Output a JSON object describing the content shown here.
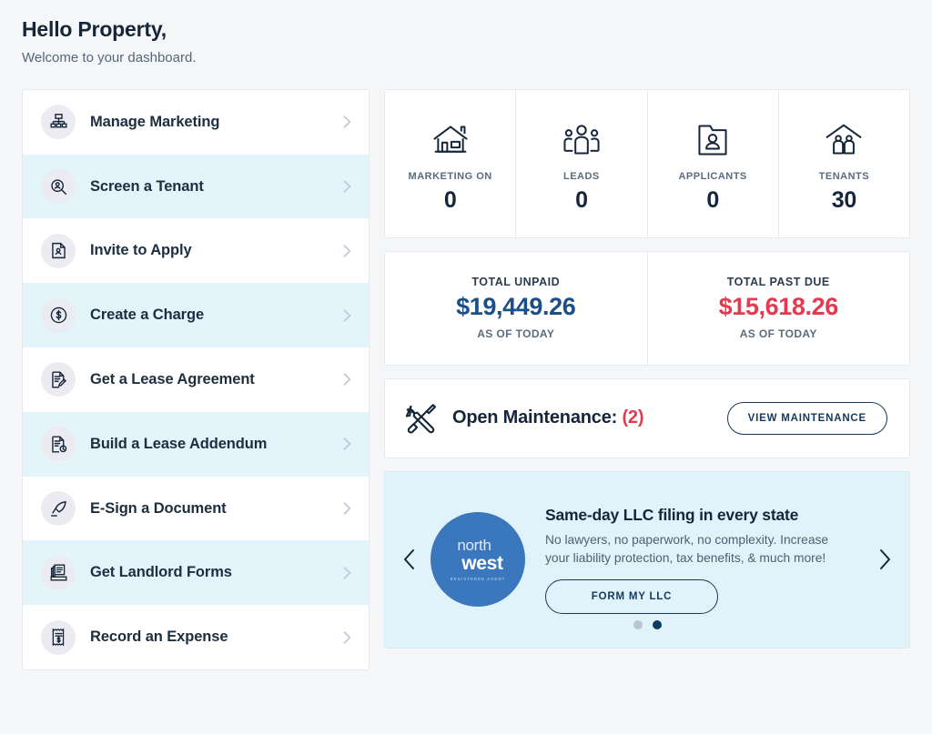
{
  "header": {
    "greeting": "Hello Property,",
    "subtitle": "Welcome to your dashboard."
  },
  "sidebar": {
    "items": [
      {
        "label": "Manage Marketing",
        "icon": "org-chart-icon"
      },
      {
        "label": "Screen a Tenant",
        "icon": "magnifier-person-icon"
      },
      {
        "label": "Invite to Apply",
        "icon": "document-person-icon"
      },
      {
        "label": "Create a Charge",
        "icon": "dollar-circle-icon"
      },
      {
        "label": "Get a Lease Agreement",
        "icon": "document-pencil-icon"
      },
      {
        "label": "Build a Lease Addendum",
        "icon": "document-refresh-icon"
      },
      {
        "label": "E-Sign a Document",
        "icon": "quill-pen-icon"
      },
      {
        "label": "Get Landlord Forms",
        "icon": "forms-tray-icon"
      },
      {
        "label": "Record an Expense",
        "icon": "receipt-dollar-icon"
      }
    ]
  },
  "stats": [
    {
      "label": "MARKETING ON",
      "value": "0",
      "icon": "house-icon"
    },
    {
      "label": "LEADS",
      "value": "0",
      "icon": "three-people-icon"
    },
    {
      "label": "APPLICANTS",
      "value": "0",
      "icon": "folder-person-icon"
    },
    {
      "label": "TENANTS",
      "value": "30",
      "icon": "roof-people-icon"
    }
  ],
  "money": [
    {
      "label": "TOTAL UNPAID",
      "value": "$19,449.26",
      "sub": "AS OF TODAY",
      "color": "#1b4f87"
    },
    {
      "label": "TOTAL PAST DUE",
      "value": "$15,618.26",
      "sub": "AS OF TODAY",
      "color": "#e8384f"
    }
  ],
  "maintenance": {
    "title": "Open Maintenance:",
    "count": "(2)",
    "button": "VIEW MAINTENANCE",
    "icon": "wrench-screwdriver-icon"
  },
  "promo": {
    "logo_top": "north",
    "logo_bottom": "west",
    "logo_sub": "REGISTERED AGENT",
    "title": "Same-day LLC filing in every state",
    "description": "No lawyers, no paperwork, no complexity. Increase your liability protection, tax benefits, & much more!",
    "button": "FORM MY LLC",
    "prev": "‹",
    "next": "›",
    "slides": 2,
    "active_slide": 2
  },
  "colors": {
    "page_bg": "#f4f6f8",
    "card_bg": "#ffffff",
    "row_alt": "#e3f4fb",
    "navy": "#16263a",
    "accent_blue": "#1b4f87",
    "danger_red": "#e8384f",
    "promo_bg": "#e0f3fb",
    "logo_blue": "#3a77bd"
  }
}
